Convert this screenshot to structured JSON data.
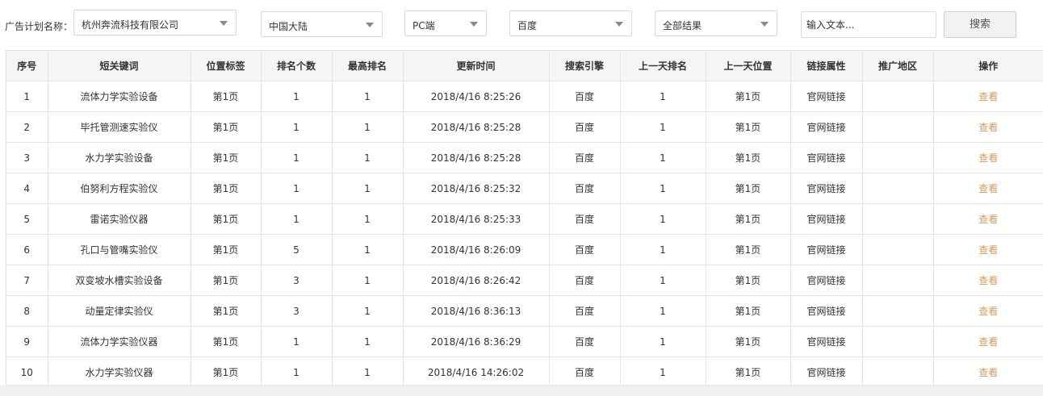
{
  "filters": {
    "plan_label": "广告计划名称：",
    "plan_select": "杭州奔流科技有限公司",
    "region_select": "中国大陆",
    "device_select": "PC端",
    "engine_select": "百度",
    "result_select": "全部结果",
    "text_placeholder": "输入文本...",
    "search_label": "搜索"
  },
  "table": {
    "headers": [
      "序号",
      "短关键词",
      "位置标签",
      "排名个数",
      "最高排名",
      "更新时间",
      "搜索引擎",
      "上一天排名",
      "上一天位置",
      "链接属性",
      "推广地区",
      "操作"
    ],
    "rows": [
      {
        "no": "1",
        "keyword": "流体力学实验设备",
        "tag": "第1页",
        "count": "1",
        "best": "1",
        "time": "2018/4/16 8:25:26",
        "engine": "百度",
        "prev_rank": "1",
        "prev_pos": "第1页",
        "link": "官网链接",
        "area": "",
        "action": "查看"
      },
      {
        "no": "2",
        "keyword": "毕托管测速实验仪",
        "tag": "第1页",
        "count": "1",
        "best": "1",
        "time": "2018/4/16 8:25:28",
        "engine": "百度",
        "prev_rank": "1",
        "prev_pos": "第1页",
        "link": "官网链接",
        "area": "",
        "action": "查看"
      },
      {
        "no": "3",
        "keyword": "水力学实验设备",
        "tag": "第1页",
        "count": "1",
        "best": "1",
        "time": "2018/4/16 8:25:28",
        "engine": "百度",
        "prev_rank": "1",
        "prev_pos": "第1页",
        "link": "官网链接",
        "area": "",
        "action": "查看"
      },
      {
        "no": "4",
        "keyword": "伯努利方程实验仪",
        "tag": "第1页",
        "count": "1",
        "best": "1",
        "time": "2018/4/16 8:25:32",
        "engine": "百度",
        "prev_rank": "1",
        "prev_pos": "第1页",
        "link": "官网链接",
        "area": "",
        "action": "查看"
      },
      {
        "no": "5",
        "keyword": "雷诺实验仪器",
        "tag": "第1页",
        "count": "1",
        "best": "1",
        "time": "2018/4/16 8:25:33",
        "engine": "百度",
        "prev_rank": "1",
        "prev_pos": "第1页",
        "link": "官网链接",
        "area": "",
        "action": "查看"
      },
      {
        "no": "6",
        "keyword": "孔口与管嘴实验仪",
        "tag": "第1页",
        "count": "5",
        "best": "1",
        "time": "2018/4/16 8:26:09",
        "engine": "百度",
        "prev_rank": "1",
        "prev_pos": "第1页",
        "link": "官网链接",
        "area": "",
        "action": "查看"
      },
      {
        "no": "7",
        "keyword": "双变坡水槽实验设备",
        "tag": "第1页",
        "count": "3",
        "best": "1",
        "time": "2018/4/16 8:26:42",
        "engine": "百度",
        "prev_rank": "1",
        "prev_pos": "第1页",
        "link": "官网链接",
        "area": "",
        "action": "查看"
      },
      {
        "no": "8",
        "keyword": "动量定律实验仪",
        "tag": "第1页",
        "count": "3",
        "best": "1",
        "time": "2018/4/16 8:36:13",
        "engine": "百度",
        "prev_rank": "1",
        "prev_pos": "第1页",
        "link": "官网链接",
        "area": "",
        "action": "查看"
      },
      {
        "no": "9",
        "keyword": "流体力学实验仪器",
        "tag": "第1页",
        "count": "1",
        "best": "1",
        "time": "2018/4/16 8:36:29",
        "engine": "百度",
        "prev_rank": "1",
        "prev_pos": "第1页",
        "link": "官网链接",
        "area": "",
        "action": "查看"
      },
      {
        "no": "10",
        "keyword": "水力学实验仪器",
        "tag": "第1页",
        "count": "1",
        "best": "1",
        "time": "2018/4/16 14:26:02",
        "engine": "百度",
        "prev_rank": "1",
        "prev_pos": "第1页",
        "link": "官网链接",
        "area": "",
        "action": "查看"
      }
    ]
  },
  "colors": {
    "action_link": "#d8985a",
    "header_bg": "#f5f5f5"
  }
}
